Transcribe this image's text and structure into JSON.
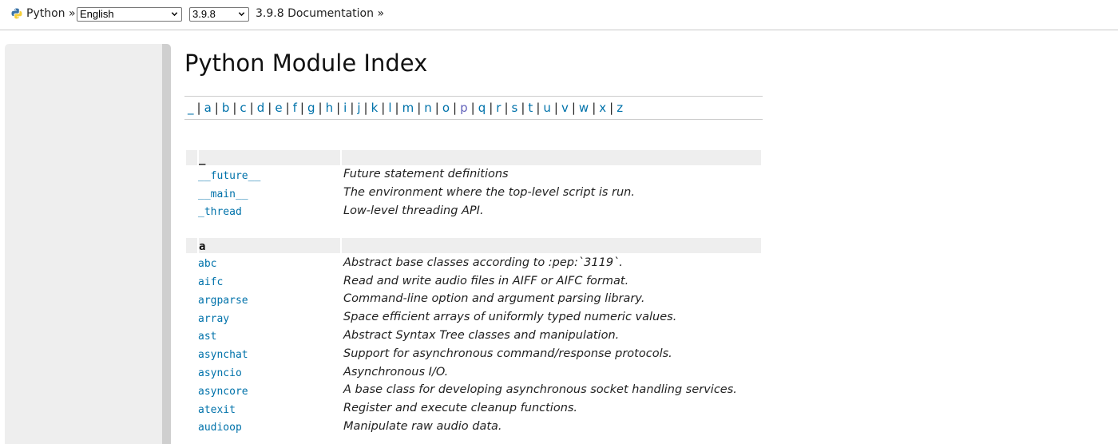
{
  "header": {
    "python_label": "Python",
    "language_select": {
      "selected": "English"
    },
    "version_select": {
      "selected": "3.9.8"
    },
    "doc_label": "3.9.8 Documentation",
    "separator": "»"
  },
  "page": {
    "title": "Python Module Index"
  },
  "letter_nav": {
    "letters": [
      "_",
      "a",
      "b",
      "c",
      "d",
      "e",
      "f",
      "g",
      "h",
      "i",
      "j",
      "k",
      "l",
      "m",
      "n",
      "o",
      "p",
      "q",
      "r",
      "s",
      "t",
      "u",
      "v",
      "w",
      "x",
      "z"
    ],
    "visited": [
      "p"
    ],
    "separator": "|"
  },
  "groups": [
    {
      "heading": "_",
      "modules": [
        {
          "name": "__future__",
          "description": "Future statement definitions"
        },
        {
          "name": "__main__",
          "description": "The environment where the top-level script is run."
        },
        {
          "name": "_thread",
          "description": "Low-level threading API."
        }
      ]
    },
    {
      "heading": "a",
      "modules": [
        {
          "name": "abc",
          "description": "Abstract base classes according to :pep:`3119`."
        },
        {
          "name": "aifc",
          "description": "Read and write audio files in AIFF or AIFC format."
        },
        {
          "name": "argparse",
          "description": "Command-line option and argument parsing library."
        },
        {
          "name": "array",
          "description": "Space efficient arrays of uniformly typed numeric values."
        },
        {
          "name": "ast",
          "description": "Abstract Syntax Tree classes and manipulation."
        },
        {
          "name": "asynchat",
          "description": "Support for asynchronous command/response protocols."
        },
        {
          "name": "asyncio",
          "description": "Asynchronous I/O."
        },
        {
          "name": "asyncore",
          "description": "A base class for developing asynchronous socket handling services."
        },
        {
          "name": "atexit",
          "description": "Register and execute cleanup functions."
        },
        {
          "name": "audioop",
          "description": "Manipulate raw audio data."
        }
      ]
    }
  ],
  "colors": {
    "link": "#0072aa",
    "visited_link": "#6363bb",
    "sidebar": "#eeeeee",
    "group_header": "#eeeeee"
  },
  "icons": {
    "logo": "python-logo-icon",
    "select_arrow": "chevron-down-icon"
  }
}
